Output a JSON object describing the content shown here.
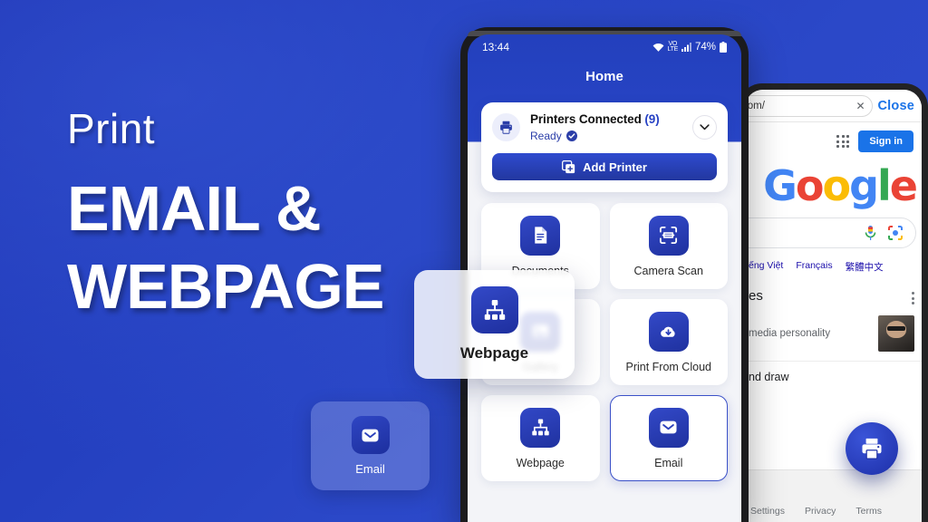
{
  "marketing": {
    "kicker": "Print",
    "headline_line1": "EMAIL &",
    "headline_line2": "WEBPAGE"
  },
  "floating_cards": {
    "email": {
      "label": "Email",
      "icon": "email-icon"
    },
    "webpage": {
      "label": "Webpage",
      "icon": "sitemap-icon"
    }
  },
  "center_phone": {
    "status_bar": {
      "time": "13:44",
      "battery": "74%",
      "icons": [
        "wifi-icon",
        "vowifi-icon",
        "signal-icon",
        "battery-icon"
      ]
    },
    "title": "Home",
    "printers_card": {
      "title": "Printers Connected",
      "count": "(9)",
      "status": "Ready",
      "printer_icon": "printer-icon",
      "verified_icon": "check-badge-icon",
      "expand_icon": "chevron-down-icon",
      "add_button": "Add Printer",
      "add_button_icon": "add-square-icon"
    },
    "tiles": [
      {
        "label": "Documents",
        "icon": "document-icon",
        "selected": false
      },
      {
        "label": "Camera Scan",
        "icon": "scan-frame-icon",
        "selected": false
      },
      {
        "label": "Gallery",
        "icon": "gallery-icon",
        "selected": false
      },
      {
        "label": "Print From Cloud",
        "icon": "cloud-download-icon",
        "selected": false
      },
      {
        "label": "Webpage",
        "icon": "sitemap-icon",
        "selected": false
      },
      {
        "label": "Email",
        "icon": "email-icon",
        "selected": true
      }
    ]
  },
  "right_phone": {
    "browser": {
      "url": "com/",
      "clear_icon": "close-x-icon",
      "close_label": "Close"
    },
    "google": {
      "apps_icon": "apps-grid-icon",
      "sign_in": "Sign in",
      "logo_letters": [
        "G",
        "o",
        "o",
        "g",
        "l",
        "e"
      ],
      "mic_icon": "microphone-icon",
      "lens_icon": "google-lens-icon",
      "languages": [
        "ếng Việt",
        "Français",
        "繁體中文"
      ],
      "section_title": "es",
      "overflow_icon": "more-vertical-icon",
      "card_text": "media personality",
      "card_thumb": "person-thumbnail",
      "row_text": "nd draw",
      "footer_links": [
        "Settings",
        "Privacy",
        "Terms"
      ]
    },
    "fab": {
      "icon": "printer-icon"
    }
  },
  "colors": {
    "background_blue_dark": "#1f35b5",
    "background_blue_light": "#2e4cd0",
    "brand_indigo": "#2742c4",
    "google_blue": "#1a73e8",
    "tile_icon_gradient_from": "#3349c8",
    "tile_icon_gradient_to": "#1f319f"
  }
}
